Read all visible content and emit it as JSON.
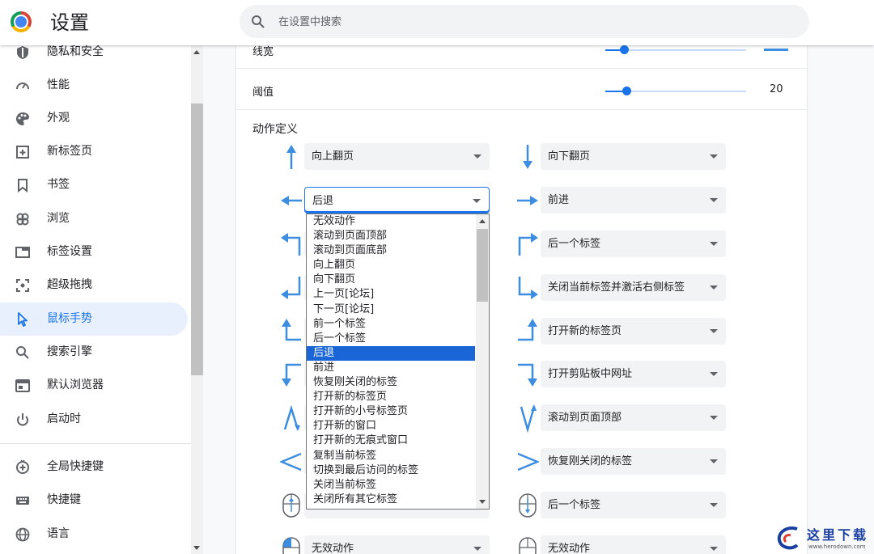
{
  "header": {
    "title": "设置",
    "search_placeholder": "在设置中搜索"
  },
  "sidebar": {
    "items": [
      {
        "label": "隐私和安全",
        "icon": "shield-icon"
      },
      {
        "label": "性能",
        "icon": "speedometer-icon"
      },
      {
        "label": "外观",
        "icon": "palette-icon"
      },
      {
        "label": "新标签页",
        "icon": "new-tab-icon"
      },
      {
        "label": "书签",
        "icon": "bookmark-icon"
      },
      {
        "label": "浏览",
        "icon": "browse-icon"
      },
      {
        "label": "标签设置",
        "icon": "tab-icon"
      },
      {
        "label": "超级拖拽",
        "icon": "drag-icon"
      },
      {
        "label": "鼠标手势",
        "icon": "cursor-icon",
        "active": true
      },
      {
        "label": "搜索引擎",
        "icon": "search-icon"
      },
      {
        "label": "默认浏览器",
        "icon": "browser-icon"
      },
      {
        "label": "启动时",
        "icon": "power-icon"
      },
      {
        "label": "全局快捷键",
        "icon": "global-shortcut-icon"
      },
      {
        "label": "快捷键",
        "icon": "keyboard-icon"
      },
      {
        "label": "语言",
        "icon": "globe-icon"
      }
    ]
  },
  "settings": {
    "line_width_label": "线宽",
    "threshold_label": "阈值",
    "threshold_value": "20",
    "actions_heading": "动作定义"
  },
  "gestures": [
    {
      "icon": "arrow-up-icon",
      "value": "向上翻页"
    },
    {
      "icon": "arrow-down-icon",
      "value": "向下翻页"
    },
    {
      "icon": "arrow-left-icon",
      "value": "后退"
    },
    {
      "icon": "arrow-right-icon",
      "value": "前进"
    },
    {
      "icon": "gesture-up-left-icon",
      "value": ""
    },
    {
      "icon": "gesture-up-right-icon",
      "value": "后一个标签"
    },
    {
      "icon": "gesture-down-left-icon",
      "value": ""
    },
    {
      "icon": "gesture-down-right-icon",
      "value": "关闭当前标签并激活右侧标签"
    },
    {
      "icon": "gesture-left-up-icon",
      "value": ""
    },
    {
      "icon": "gesture-right-up-icon",
      "value": "打开新的标签页"
    },
    {
      "icon": "gesture-left-down-icon",
      "value": ""
    },
    {
      "icon": "gesture-right-down-icon",
      "value": "打开剪贴板中网址"
    },
    {
      "icon": "gesture-caret-up-icon",
      "value": ""
    },
    {
      "icon": "gesture-v-icon",
      "value": "滚动到页面顶部"
    },
    {
      "icon": "gesture-less-than-icon",
      "value": ""
    },
    {
      "icon": "gesture-greater-than-icon",
      "value": "恢复刚关闭的标签"
    },
    {
      "icon": "mouse-wheel-up-icon",
      "value": ""
    },
    {
      "icon": "mouse-wheel-down-icon",
      "value": "后一个标签"
    },
    {
      "icon": "mouse-left-button-icon",
      "value": "无效动作"
    },
    {
      "icon": "mouse-right-button-icon",
      "value": "无效动作"
    }
  ],
  "dropdown": {
    "options": [
      "无效动作",
      "滚动到页面顶部",
      "滚动到页面底部",
      "向上翻页",
      "向下翻页",
      "上一页[论坛]",
      "下一页[论坛]",
      "前一个标签",
      "后一个标签",
      "后退",
      "前进",
      "恢复刚关闭的标签",
      "打开新的标签页",
      "打开新的小号标签页",
      "打开新的窗口",
      "打开新的无痕式窗口",
      "复制当前标签",
      "切换到最后访问的标签",
      "关闭当前标签",
      "关闭所有其它标签"
    ],
    "selected": "后退"
  },
  "watermark": {
    "title": "这里下载",
    "url": "www.herodown.com"
  },
  "colors": {
    "accent": "#1a73e8",
    "gesture_blue": "#3d8de0",
    "highlight": "#1a66d6"
  }
}
